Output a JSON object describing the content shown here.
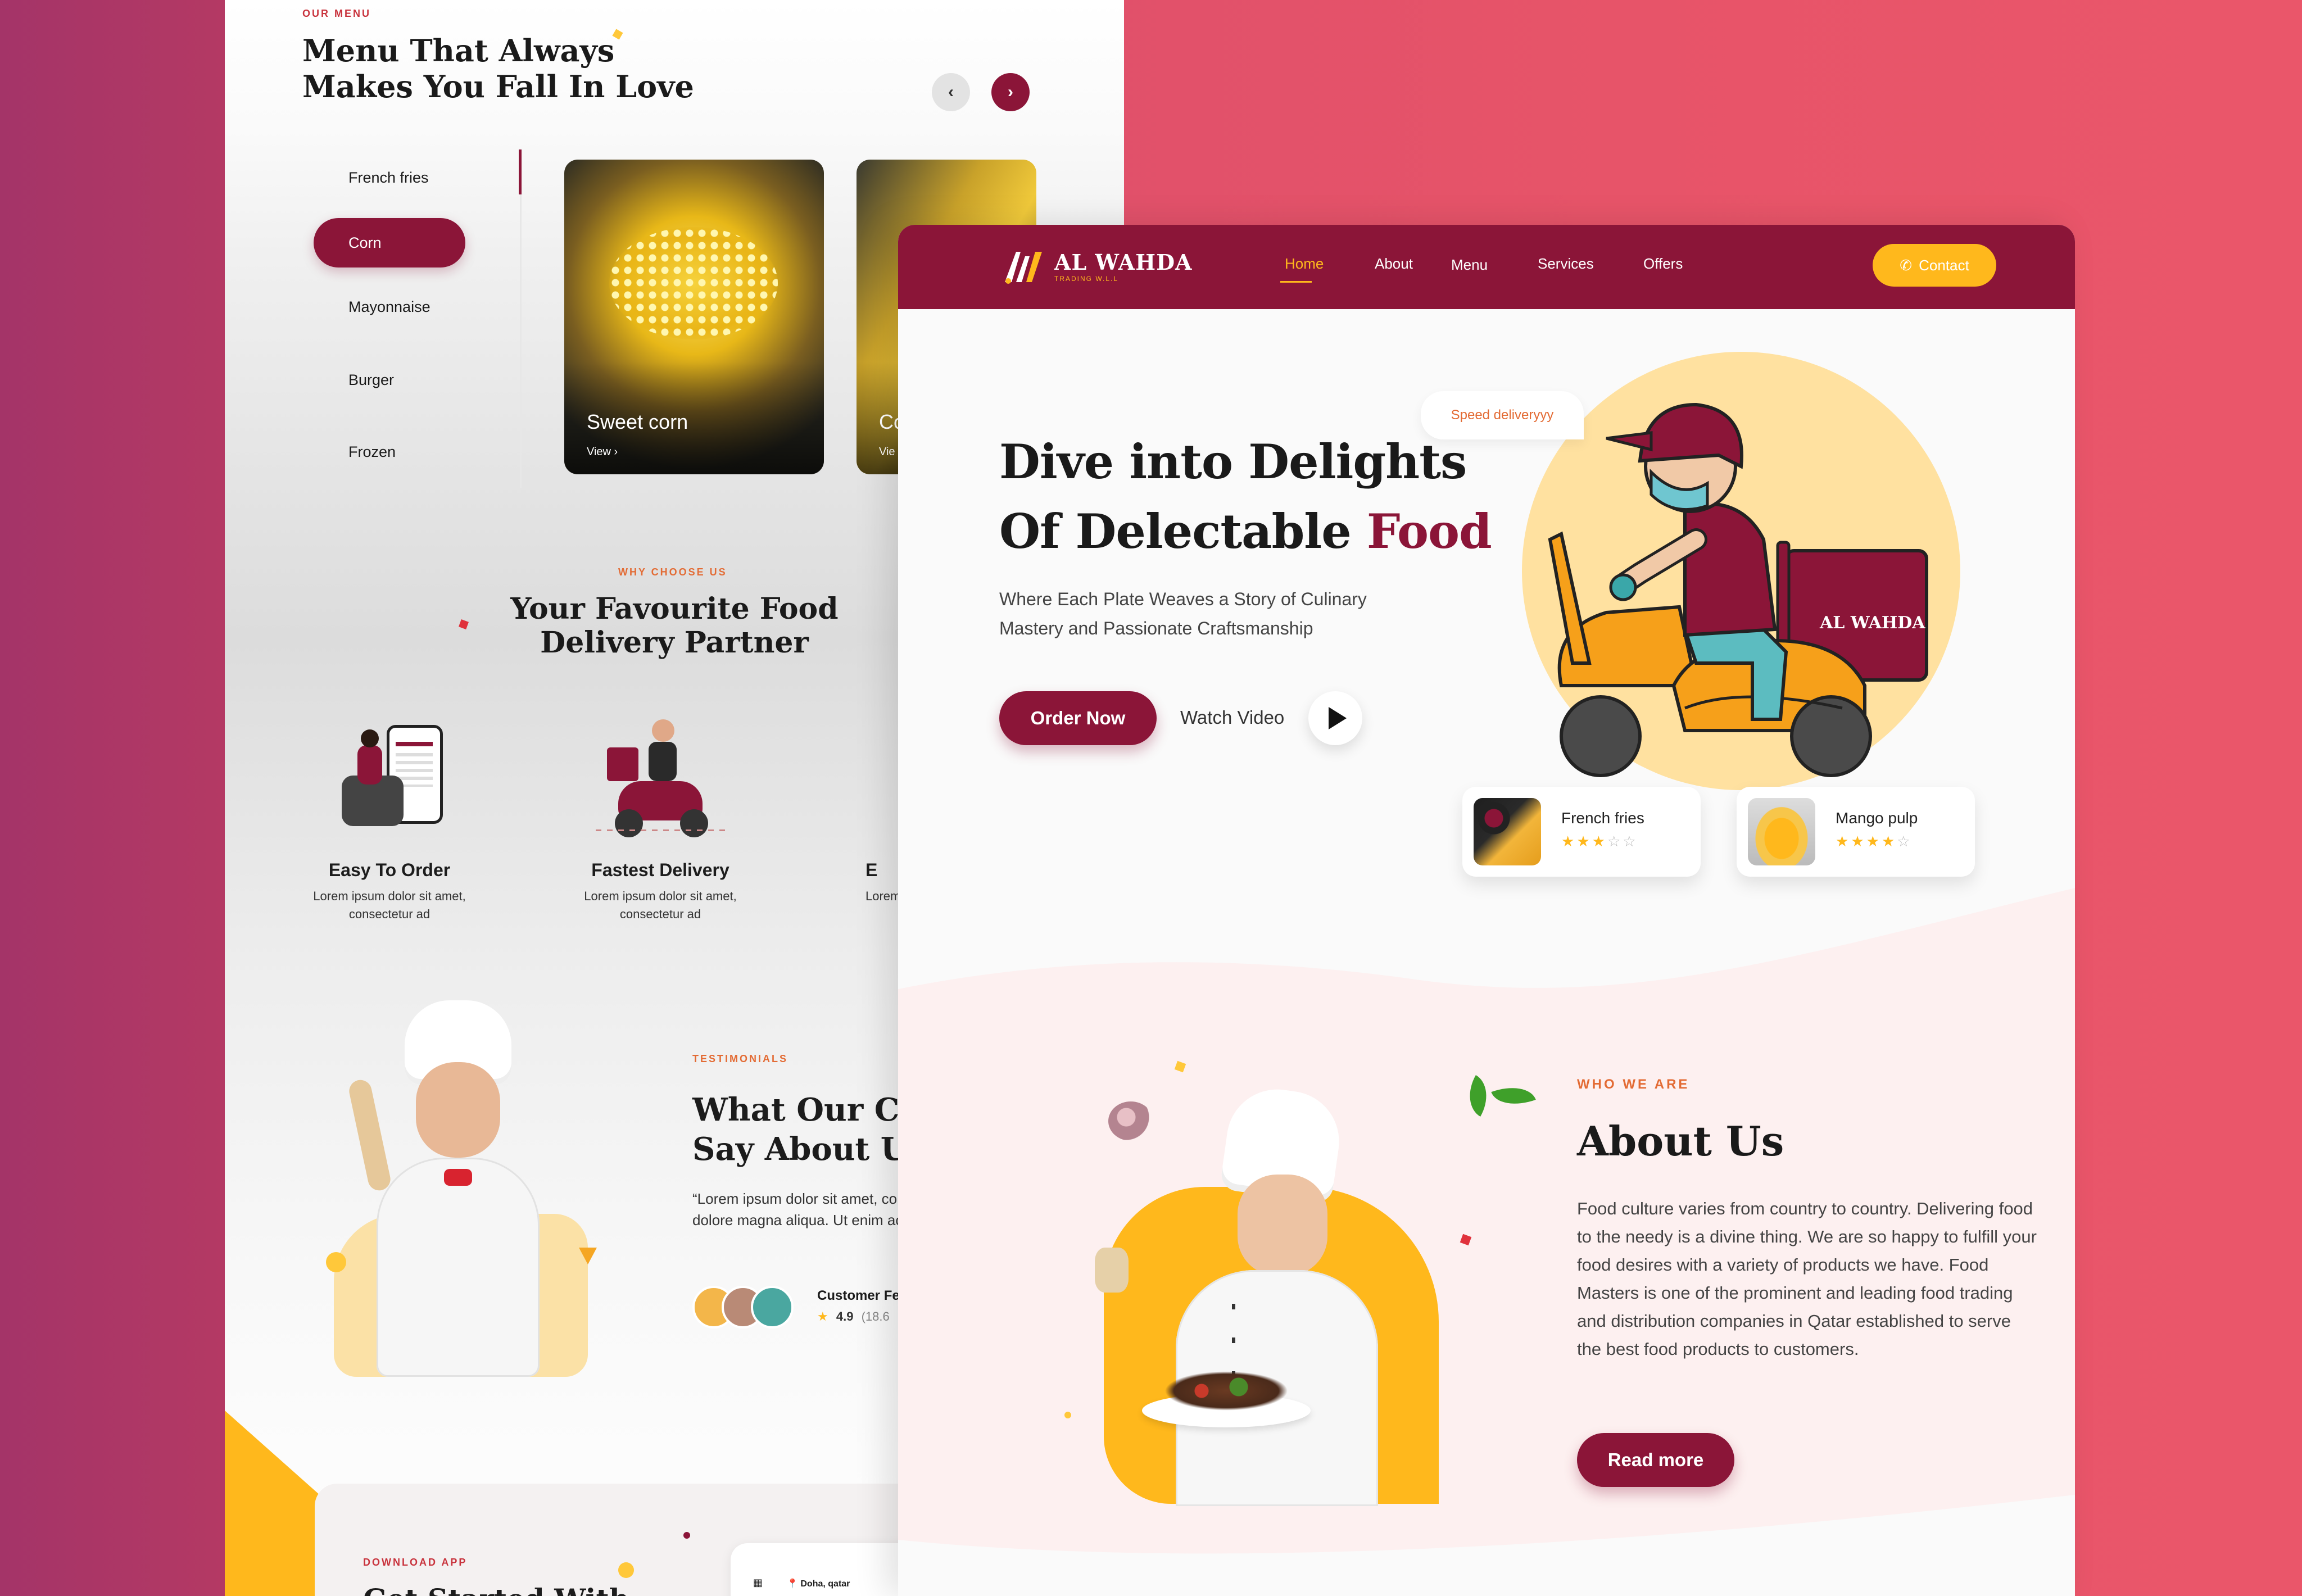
{
  "back_page": {
    "menu_section": {
      "eyebrow": "OUR MENU",
      "title_line1": "Menu That Always",
      "title_line2": "Makes You Fall In Love",
      "prev_icon": "chevron-left-icon",
      "next_icon": "chevron-right-icon",
      "categories": [
        "French fries",
        "Corn",
        "Mayonnaise",
        "Burger",
        "Frozen"
      ],
      "active_category": "Corn",
      "cards": [
        {
          "name": "Sweet corn",
          "link": "View"
        },
        {
          "name": "Co",
          "link": "Vie"
        }
      ]
    },
    "why_section": {
      "eyebrow": "WHY CHOOSE US",
      "title_line1": "Your Favourite Food",
      "title_line2": "Delivery Partner",
      "features": [
        {
          "title": "Easy To Order",
          "desc_line1": "Lorem ipsum dolor sit amet,",
          "desc_line2": "consectetur ad"
        },
        {
          "title": "Fastest Delivery",
          "desc_line1": "Lorem ipsum dolor sit amet,",
          "desc_line2": "consectetur ad"
        },
        {
          "title": "E",
          "desc_line1": "Lorem",
          "desc_line2": ""
        }
      ]
    },
    "testimonials": {
      "eyebrow": "TESTIMONIALS",
      "title_line1": "What Our Custo",
      "title_line2": "Say About Us",
      "quote": "“Lorem ipsum dolor sit amet, co elit, sed do eiusmod tempor inci dolore magna aliqua. Ut enim ac",
      "feedback_label": "Customer Fe",
      "rating": "4.9",
      "rating_count": "(18.6"
    },
    "download": {
      "eyebrow": "DOWNLOAD APP",
      "title_partial": "Get Started With",
      "location": "Doha, qatar"
    }
  },
  "front_page": {
    "brand": {
      "name": "AL WAHDA",
      "tagline": "TRADING W.L.L"
    },
    "nav": {
      "items": [
        "Home",
        "About",
        "Menu",
        "Services",
        "Offers"
      ],
      "active": "Home",
      "contact_label": "Contact",
      "contact_icon": "phone-icon"
    },
    "hero": {
      "title_line1": "Dive into Delights",
      "title_line2_prefix": "Of Delectable",
      "title_accent": "Food",
      "subtitle": "Where Each Plate Weaves a Story of Culinary Mastery and Passionate Craftsmanship",
      "order_button": "Order Now",
      "watch_label": "Watch Video",
      "play_icon": "play-icon",
      "bubble": "Speed deliveryyy",
      "box_brand": "AL WAHDA",
      "products": [
        {
          "name": "French fries",
          "rating": 3,
          "max": 5
        },
        {
          "name": "Mango pulp",
          "rating": 4,
          "max": 5
        }
      ]
    },
    "about": {
      "eyebrow": "WHO WE ARE",
      "title": "About Us",
      "body": "Food culture varies from country to country. Delivering food to the needy is a divine thing. We are so happy to fulfill your food desires with a variety of products we have. Food Masters is one of the prominent and leading food trading and distribution companies in Qatar established to serve the best food products to customers.",
      "button": "Read more"
    }
  },
  "colors": {
    "brand_maroon": "#8b1538",
    "accent_yellow": "#ffb81c",
    "background_pink": "#e75469",
    "eyebrow_red": "#c8323c"
  }
}
